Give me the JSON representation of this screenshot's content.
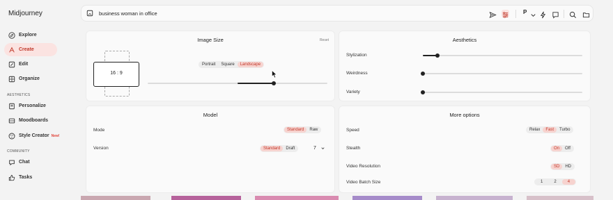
{
  "app": {
    "logo": "Midjourney"
  },
  "sidebar": {
    "items": [
      {
        "label": "Explore",
        "icon": "compass-icon"
      },
      {
        "label": "Create",
        "icon": "pen-icon",
        "active": true
      },
      {
        "label": "Edit",
        "icon": "edit-icon"
      },
      {
        "label": "Organize",
        "icon": "grid-icon"
      }
    ],
    "aesthetics_header": "AESTHETICS",
    "aesthetics_items": [
      {
        "label": "Personalize",
        "icon": "personalize-icon"
      },
      {
        "label": "Moodboards",
        "icon": "moodboard-icon"
      },
      {
        "label": "Style Creator",
        "icon": "palette-icon",
        "badge": "New!"
      }
    ],
    "community_header": "COMMUNITY",
    "community_items": [
      {
        "label": "Chat",
        "icon": "chat-icon"
      },
      {
        "label": "Tasks",
        "icon": "thumbs-up-icon"
      }
    ]
  },
  "search": {
    "value": "business woman in office",
    "personalize_label": "P"
  },
  "image_size": {
    "title": "Image Size",
    "reset": "Reset",
    "aspect_ratio": "16 : 9",
    "orientations": [
      "Portrait",
      "Square",
      "Landscape"
    ],
    "selected_orientation": "Landscape",
    "size_slider_level": 0.7
  },
  "aesthetics": {
    "title": "Aesthetics",
    "stylization_label": "Stylization",
    "stylization_level": 0.09,
    "weirdness_label": "Weirdness",
    "weirdness_level": 0,
    "variety_label": "Variety",
    "variety_level": 0
  },
  "model": {
    "title": "Model",
    "mode_label": "Mode",
    "mode_options": [
      "Standard",
      "Raw"
    ],
    "mode_selected": "Standard",
    "version_label": "Version",
    "version_options": [
      "Standard",
      "Draft"
    ],
    "version_selected": "Standard",
    "version_number": "7"
  },
  "more_options": {
    "title": "More options",
    "speed_label": "Speed",
    "speed_options": [
      "Relax",
      "Fast",
      "Turbo"
    ],
    "speed_selected": "Fast",
    "stealth_label": "Stealth",
    "stealth_options": [
      "On",
      "Off"
    ],
    "stealth_selected": "On",
    "video_resolution_label": "Video Resolution",
    "video_resolution_options": [
      "SD",
      "HD"
    ],
    "video_resolution_selected": "SD",
    "video_batch_label": "Video Batch Size",
    "video_batch_options": [
      "1",
      "2",
      "4"
    ],
    "video_batch_selected": "4"
  },
  "colors": {
    "accent": "#e0443a",
    "accent_bg": "#fbe3e1",
    "selected_segment": "#f7d3cf"
  }
}
